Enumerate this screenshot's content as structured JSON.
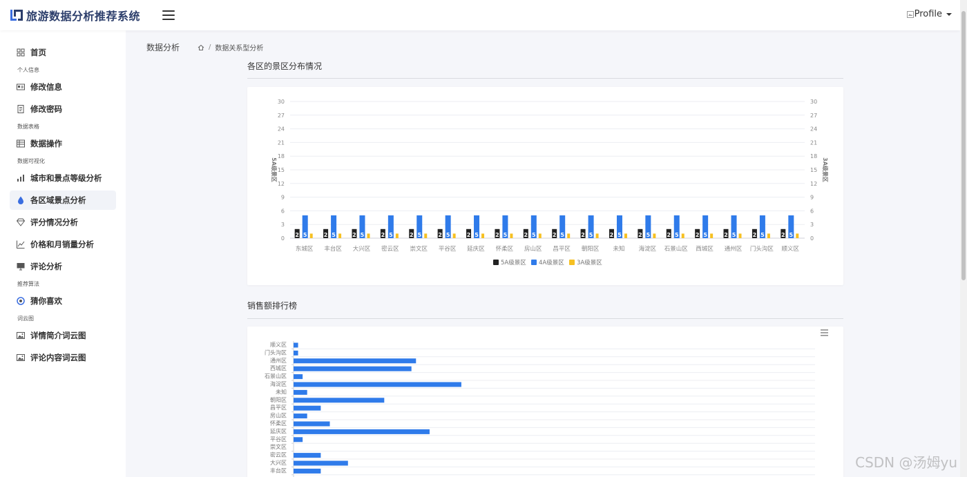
{
  "app": {
    "title": "旅游数据分析推荐系统",
    "profile_label": "Profile"
  },
  "colors": {
    "accent": "#3a6de0",
    "series_5a": "#222222",
    "series_4a": "#2f7bea",
    "series_3a": "#f6c022",
    "sales_bar": "#2f7bea"
  },
  "sidebar": {
    "items": [
      {
        "type": "item",
        "label": "首页",
        "icon": "grid-icon"
      },
      {
        "type": "group",
        "label": "个人信息"
      },
      {
        "type": "item",
        "label": "修改信息",
        "icon": "id-card-icon"
      },
      {
        "type": "item",
        "label": "修改密码",
        "icon": "document-icon"
      },
      {
        "type": "group",
        "label": "数据表格"
      },
      {
        "type": "item",
        "label": "数据操作",
        "icon": "table-icon"
      },
      {
        "type": "group",
        "label": "数据可视化"
      },
      {
        "type": "item",
        "label": "城市和景点等级分析",
        "icon": "bar-chart-icon"
      },
      {
        "type": "item",
        "label": "各区域景点分析",
        "icon": "drop-icon",
        "active": true
      },
      {
        "type": "item",
        "label": "评分情况分析",
        "icon": "diamond-icon"
      },
      {
        "type": "item",
        "label": "价格和月销量分析",
        "icon": "line-chart-icon"
      },
      {
        "type": "item",
        "label": "评论分析",
        "icon": "monitor-icon"
      },
      {
        "type": "group",
        "label": "推荐算法"
      },
      {
        "type": "item",
        "label": "猜你喜欢",
        "icon": "target-icon"
      },
      {
        "type": "group",
        "label": "词云图"
      },
      {
        "type": "item",
        "label": "详情简介词云图",
        "icon": "image-icon"
      },
      {
        "type": "item",
        "label": "评论内容词云图",
        "icon": "image-icon"
      }
    ]
  },
  "page": {
    "title": "数据分析",
    "breadcrumb": {
      "home_icon": "home-icon",
      "separator": "/",
      "current": "数据关系型分析"
    }
  },
  "sections": {
    "district_title": "各区的景区分布情况",
    "sales_title": "销售额排行榜"
  },
  "chart_data": [
    {
      "type": "bar",
      "categories": [
        "东城区",
        "丰台区",
        "大兴区",
        "密云区",
        "崇文区",
        "平谷区",
        "延庆区",
        "怀柔区",
        "房山区",
        "昌平区",
        "朝阳区",
        "未知",
        "海淀区",
        "石景山区",
        "西城区",
        "通州区",
        "门头沟区",
        "顺义区"
      ],
      "series": [
        {
          "name": "5A级景区",
          "values": [
            2,
            2,
            2,
            2,
            2,
            2,
            2,
            2,
            2,
            2,
            2,
            2,
            2,
            2,
            2,
            2,
            2,
            2
          ],
          "labels": [
            "2",
            "2",
            "2",
            "2",
            "2",
            "2",
            "2",
            "2",
            "2",
            "2",
            "2",
            "2",
            "2",
            "2",
            "2",
            "2",
            "2",
            "2"
          ]
        },
        {
          "name": "4A级景区",
          "values": [
            5,
            5,
            5,
            5,
            5,
            5,
            5,
            5,
            5,
            5,
            5,
            5,
            5,
            5,
            5,
            5,
            5,
            5
          ],
          "labels": [
            "5",
            "5",
            "5",
            "5",
            "5",
            "5",
            "5",
            "5",
            "5",
            "5",
            "5",
            "5",
            "5",
            "5",
            "5",
            "5",
            "5",
            "5"
          ]
        },
        {
          "name": "3A级景区",
          "values": [
            1,
            1,
            1,
            1,
            1,
            1,
            1,
            1,
            1,
            1,
            1,
            1,
            1,
            1,
            1,
            1,
            1,
            1
          ]
        }
      ],
      "ylabel": "5A级景区",
      "y2label": "3A级景区",
      "ylim": [
        0,
        30
      ],
      "yticks": [
        "0",
        "3",
        "6",
        "9",
        "12",
        "15",
        "18",
        "21",
        "24",
        "27",
        "30"
      ],
      "grid": true,
      "legend": "bottom"
    },
    {
      "type": "bar",
      "orientation": "horizontal",
      "categories": [
        "顺义区",
        "门头沟区",
        "通州区",
        "西城区",
        "石景山区",
        "海淀区",
        "未知",
        "朝阳区",
        "昌平区",
        "房山区",
        "怀柔区",
        "延庆区",
        "平谷区",
        "崇文区",
        "密云区",
        "大兴区",
        "丰台区"
      ],
      "values": [
        1,
        1,
        27,
        26,
        2,
        37,
        3,
        20,
        6,
        3,
        8,
        30,
        2,
        0,
        6,
        12,
        6
      ],
      "xlim": [
        0,
        115
      ],
      "grid": true,
      "toolbox_icon": "menu-icon"
    }
  ],
  "watermark": "CSDN @汤姆yu"
}
